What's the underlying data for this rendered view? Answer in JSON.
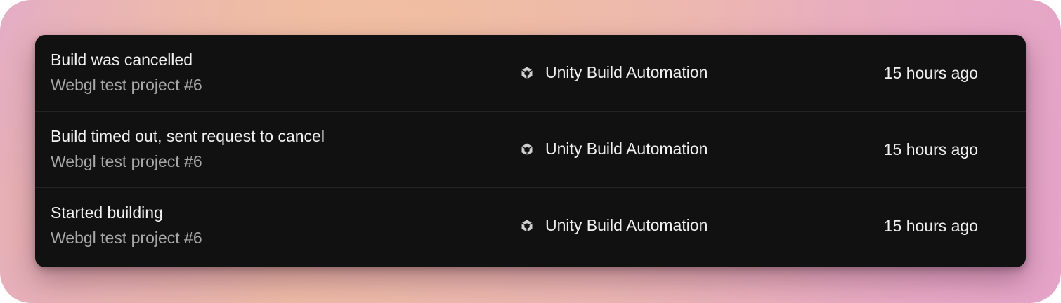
{
  "activity": {
    "rows": [
      {
        "title": "Build was cancelled",
        "subtitle": "Webgl test project #6",
        "source_icon": "unity-logo-icon",
        "source": "Unity Build Automation",
        "time": "15 hours ago"
      },
      {
        "title": "Build timed out, sent request to cancel",
        "subtitle": "Webgl test project #6",
        "source_icon": "unity-logo-icon",
        "source": "Unity Build Automation",
        "time": "15 hours ago"
      },
      {
        "title": "Started building",
        "subtitle": "Webgl test project #6",
        "source_icon": "unity-logo-icon",
        "source": "Unity Build Automation",
        "time": "15 hours ago"
      }
    ]
  }
}
